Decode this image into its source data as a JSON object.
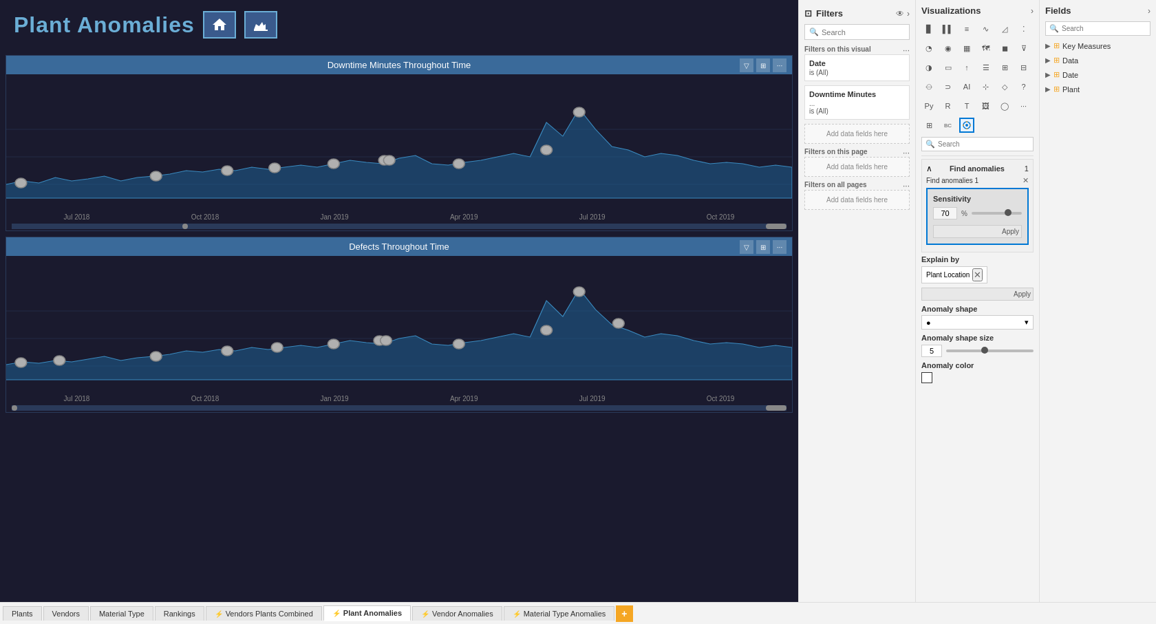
{
  "app": {
    "title": "Plant Anomalies",
    "titleIcons": [
      "home-icon",
      "factory-icon"
    ]
  },
  "charts": [
    {
      "id": "chart1",
      "title": "Downtime Minutes Throughout Time",
      "xLabels": [
        "Jul 2018",
        "Oct 2018",
        "Jan 2019",
        "Apr 2019",
        "Jul 2019",
        "Oct 2019"
      ]
    },
    {
      "id": "chart2",
      "title": "Defects Throughout Time",
      "xLabels": [
        "Jul 2018",
        "Oct 2018",
        "Jan 2019",
        "Apr 2019",
        "Jul 2019",
        "Oct 2019"
      ]
    }
  ],
  "filters": {
    "panelTitle": "Filters",
    "searchPlaceholder": "Search",
    "onThisVisual": "Filters on this visual",
    "onThisPage": "Filters on this page",
    "onAllPages": "Filters on all pages",
    "addDataFields": "Add data fields here",
    "dateFilter": {
      "name": "Date",
      "value": "is (All)"
    },
    "downtimeFilter": {
      "name": "Downtime Minutes",
      "value": "..."
    },
    "downtimeValue": "is (All)"
  },
  "visualizations": {
    "panelTitle": "Visualizations",
    "searchPlaceholder": "Search",
    "findAnomalies": {
      "label": "Find anomalies",
      "count": "1",
      "sublabel": "Find anomalies 1"
    },
    "sensitivity": {
      "label": "Sensitivity",
      "value": "70",
      "unit": "%",
      "applyLabel": "Apply"
    },
    "explainBy": {
      "label": "Explain by",
      "tag": "Plant Location",
      "applyLabel": "Apply"
    },
    "anomalyShape": {
      "label": "Anomaly shape",
      "value": "●",
      "dropdownArrow": "▾"
    },
    "anomalyShapeSize": {
      "label": "Anomaly shape size",
      "value": "5"
    },
    "anomalyColor": {
      "label": "Anomaly color"
    }
  },
  "fields": {
    "panelTitle": "Fields",
    "searchPlaceholder": "Search",
    "items": [
      {
        "name": "Key Measures",
        "type": "table"
      },
      {
        "name": "Data",
        "type": "table"
      },
      {
        "name": "Date",
        "type": "table"
      },
      {
        "name": "Plant",
        "type": "table"
      }
    ]
  },
  "tabs": [
    {
      "label": "Plants",
      "hasIcon": false,
      "active": false
    },
    {
      "label": "Vendors",
      "hasIcon": false,
      "active": false
    },
    {
      "label": "Material Type",
      "hasIcon": false,
      "active": false
    },
    {
      "label": "Rankings",
      "hasIcon": false,
      "active": false
    },
    {
      "label": "Vendors Plants Combined",
      "hasIcon": true,
      "active": false
    },
    {
      "label": "Plant Anomalies",
      "hasIcon": true,
      "active": true
    },
    {
      "label": "Vendor Anomalies",
      "hasIcon": true,
      "active": false
    },
    {
      "label": "Material Type Anomalies",
      "hasIcon": true,
      "active": false
    }
  ],
  "addTabLabel": "+"
}
